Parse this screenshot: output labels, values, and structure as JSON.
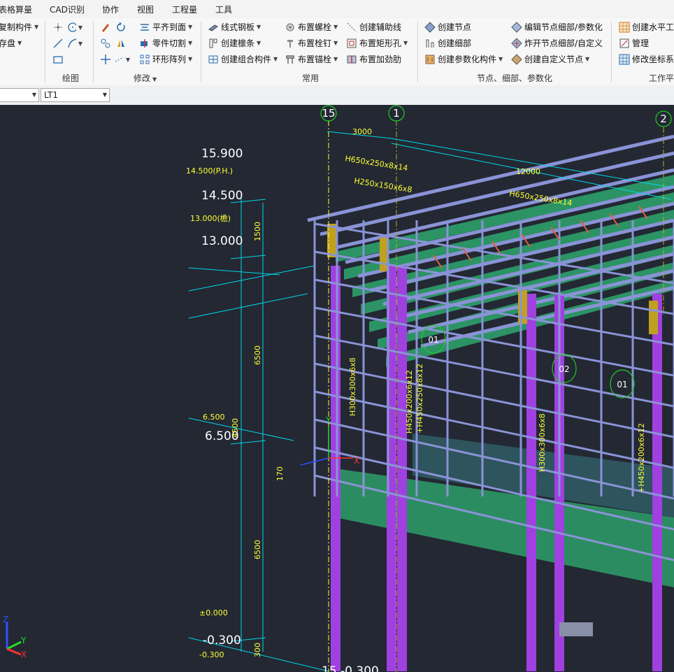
{
  "menu": [
    "表格算量",
    "CAD识别",
    "协作",
    "视图",
    "工程量",
    "工具"
  ],
  "ribbon": {
    "left_items": [
      "复制构件",
      "存盘"
    ],
    "draw_group": "绘图",
    "modify": {
      "align": "平齐到面",
      "cut": "零件切割",
      "array": "环形阵列",
      "group": "修改"
    },
    "common": {
      "line_plate": "线式钢板",
      "create_purlin": "创建檩条",
      "create_combo": "创建组合构件",
      "bolt": "布置螺栓",
      "stud": "布置栓钉",
      "anchor": "布置锚栓",
      "aux_line": "创建辅助线",
      "rect_hole": "布置矩形孔",
      "stiffener": "布置加劲肋",
      "group": "常用"
    },
    "node": {
      "create_node": "创建节点",
      "create_detail": "创建细部",
      "create_param": "创建参数化构件",
      "edit_node": "编辑节点细部/参数化",
      "explode_node": "炸开节点细部/自定义",
      "custom_node": "创建自定义节点",
      "group": "节点、细部、参数化"
    },
    "workplane": {
      "create_hplane": "创建水平工",
      "manage": "管理",
      "modify_ucs": "修改坐标系",
      "group": "工作平"
    }
  },
  "propbar": {
    "combo1": "",
    "combo2": "LT1"
  },
  "cad": {
    "axis_15": "15",
    "axis_1": "1",
    "axis_2": "2",
    "elev_15900": "15.900",
    "elev_14500": "14.500",
    "elev_14500_ph": "14.500(P.H.)",
    "elev_13000": "13.000",
    "elev_13000_small": "13.000(檐)",
    "elev_6500": "6.500",
    "elev_6500_small": "6.500",
    "elev_0": "±0.000",
    "elev_m0300": "-0.300",
    "elev_m0300_small": "-0.300",
    "bottom_text": "15 -0.300",
    "dim_3000": "3000",
    "dim_12000": "12000",
    "dim_1500": "1500",
    "dim_6500a": "6500",
    "dim_6500b": "6500",
    "dim_4500": "4500",
    "dim_170": "170",
    "dim_300": "300",
    "sec_h650a": "H650x250x8x14",
    "sec_h650b": "H650x250x8x14",
    "sec_h250": "H250x150x6x8",
    "sec_h300": "H300x300x6x8",
    "sec_h450a": "H450x200x6x12",
    "sec_h450b": "+H450x250x8x12",
    "sec_h300b": "H300x300x6x8",
    "sec_h450c": "+H450x200x6x12",
    "tag_01a": "01",
    "tag_02": "02",
    "tag_01b": "01",
    "ucs_x": "X",
    "ucs_y": "Y",
    "ucs_z": "Z",
    "wcs_x": "X",
    "wcs_y": "Y",
    "wcs_z": "Z"
  },
  "colors": {
    "viewport_bg": "#232833",
    "column": "#a040e0",
    "beam": "#8a93d6",
    "slab": "#2e9e6a",
    "dimension": "#00d8e8",
    "annotation": "#ffff33",
    "axis_bubble": "#22cc22",
    "brace": "#e06040"
  }
}
